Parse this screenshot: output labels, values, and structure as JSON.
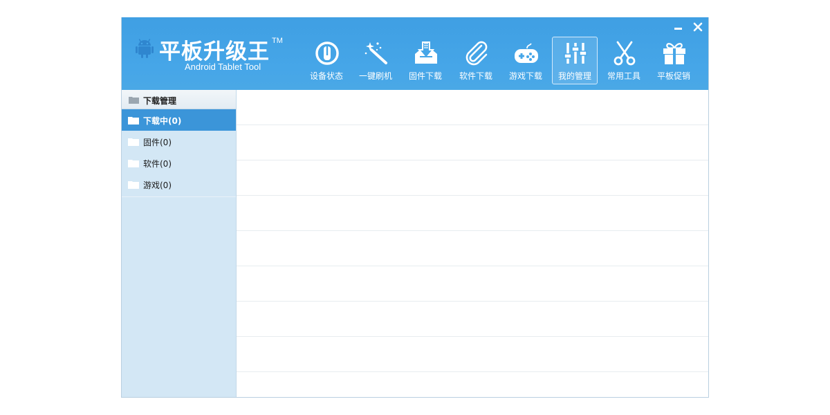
{
  "app": {
    "title": "平板升级王",
    "trademark": "TM",
    "subtitle": "Android Tablet Tool"
  },
  "window_controls": {
    "minimize": "minimize",
    "close": "close"
  },
  "toolbar": {
    "items": [
      {
        "label": "设备状态",
        "icon": "power-icon"
      },
      {
        "label": "一键刷机",
        "icon": "magic-wand-icon"
      },
      {
        "label": "固件下载",
        "icon": "download-tray-icon"
      },
      {
        "label": "软件下载",
        "icon": "paperclip-icon"
      },
      {
        "label": "游戏下载",
        "icon": "gamepad-icon"
      },
      {
        "label": "我的管理",
        "icon": "sliders-icon",
        "active": true
      },
      {
        "label": "常用工具",
        "icon": "scissors-icon"
      },
      {
        "label": "平板促销",
        "icon": "gift-icon"
      }
    ]
  },
  "sidebar": {
    "header": "下载管理",
    "items": [
      {
        "label": "下载中(0)",
        "active": true
      },
      {
        "label": "固件(0)"
      },
      {
        "label": "软件(0)"
      },
      {
        "label": "游戏(0)"
      }
    ]
  },
  "colors": {
    "header": "#46a6e8",
    "sidebar": "#d3e7f5",
    "active_item": "#3b95d9"
  }
}
